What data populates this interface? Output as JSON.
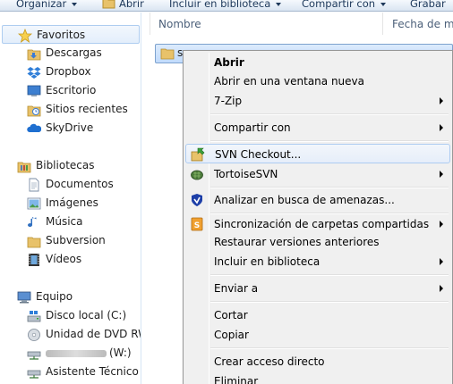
{
  "toolbar": {
    "organize": "Organizar",
    "open": "Abrir",
    "include": "Incluir en biblioteca",
    "share": "Compartir con",
    "burn": "Grabar"
  },
  "columns": {
    "name": "Nombre",
    "date": "Fecha de mo"
  },
  "file": {
    "name": "s"
  },
  "nav": {
    "favorites": "Favoritos",
    "downloads": "Descargas",
    "dropbox": "Dropbox",
    "desktop": "Escritorio",
    "recent": "Sitios recientes",
    "skydrive": "SkyDrive",
    "libraries": "Bibliotecas",
    "documents": "Documentos",
    "images": "Imágenes",
    "music": "Música",
    "subversion": "Subversion",
    "videos": "Vídeos",
    "computer": "Equipo",
    "local_disk": "Disco local (C:)",
    "dvd": "Unidad de DVD RW (",
    "network_drive": "(W:)",
    "assistant": "Asistente Técnico G"
  },
  "menu": {
    "open": "Abrir",
    "open_new": "Abrir en una ventana nueva",
    "zip": "7-Zip",
    "share": "Compartir con",
    "svn_checkout": "SVN Checkout...",
    "tortoise": "TortoiseSVN",
    "scan": "Analizar en busca de amenazas...",
    "sync": "Sincronización de carpetas compartidas",
    "restore": "Restaurar versiones anteriores",
    "include": "Incluir en biblioteca",
    "send_to": "Enviar a",
    "cut": "Cortar",
    "copy": "Copiar",
    "shortcut": "Crear acceso directo",
    "delete": "Eliminar"
  },
  "colors": {
    "selection": "#cce4f7",
    "hover_border": "#aeccf1",
    "folder": "#e8c26a"
  }
}
